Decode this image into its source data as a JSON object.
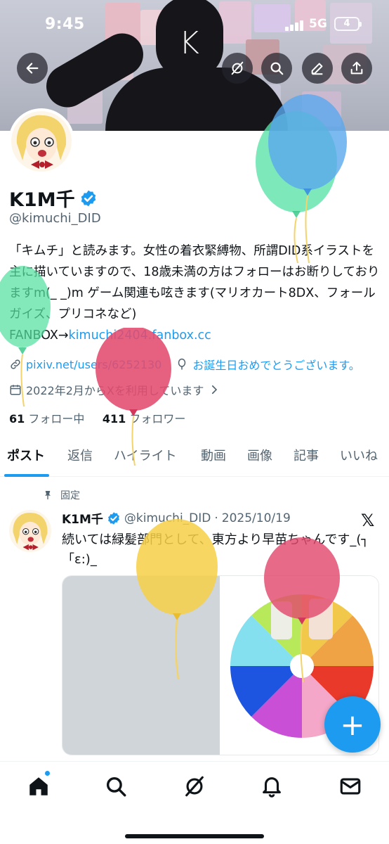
{
  "status_bar": {
    "time": "9:45",
    "network": "5G",
    "battery": "4"
  },
  "header": {
    "banner_letter": "K"
  },
  "profile": {
    "display_name": "K1M千",
    "handle": "@kimuchi_DID",
    "bio": "「キムチ」と読みます。女性の着衣緊縛物、所謂DID系イラストを主に描いていますので、18歳未満の方はフォローはお断りしておりますm(_ _)m ゲーム関連も呟きます(マリオカート8DX、フォールガイズ、プリコネなど)",
    "bio_link_prefix": "FANBOX→",
    "bio_link": "kimuchi2404.fanbox.cc",
    "website": "pixiv.net/users/6252130",
    "birthday": "お誕生日おめでとうございます。",
    "joined": "2022年2月からXを利用しています",
    "following_count": "61",
    "following_label": "フォロー中",
    "followers_count": "411",
    "followers_label": "フォロワー"
  },
  "tabs": [
    "ポスト",
    "返信",
    "ハイライト",
    "動画",
    "画像",
    "記事",
    "いいね"
  ],
  "post": {
    "pinned_label": "固定",
    "author": "K1M千",
    "handle": "@kimuchi_DID",
    "separator": "·",
    "date": "2025/10/19",
    "text": "続いては緑髪部門として、東方より早苗ちゃんです_(┐「ε:)_"
  },
  "fab_label": "+",
  "colors": {
    "accent": "#1d9bf0",
    "text": "#0f1419",
    "secondary": "#536471"
  }
}
